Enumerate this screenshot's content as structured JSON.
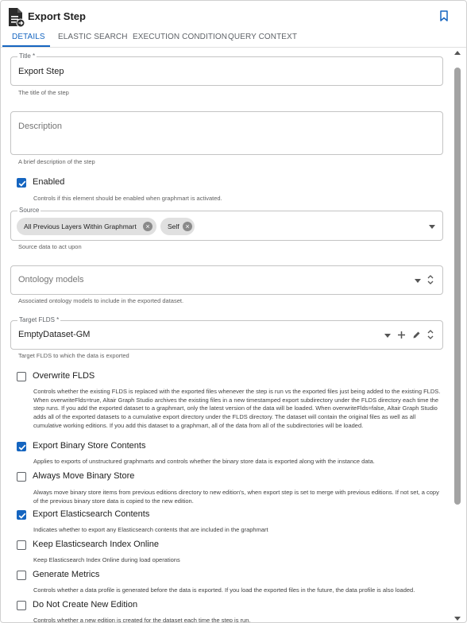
{
  "header": {
    "title": "Export Step",
    "icon": "document-export-icon",
    "bookmark_icon": "bookmark-icon"
  },
  "tabs": [
    {
      "label": "DETAILS",
      "active": true
    },
    {
      "label": "ELASTIC SEARCH",
      "active": false
    },
    {
      "label": "EXECUTION CONDITION",
      "active": false
    },
    {
      "label": "QUERY CONTEXT",
      "active": false
    }
  ],
  "form": {
    "title": {
      "label": "Title *",
      "value": "Export Step",
      "hint": "The title of the step"
    },
    "description": {
      "placeholder": "Description",
      "hint": "A brief description of the step"
    },
    "enabled": {
      "label": "Enabled",
      "checked": true,
      "hint": "Controls if this element should be enabled when graphmart is activated."
    },
    "source": {
      "label": "Source",
      "chips": [
        "All Previous Layers Within Graphmart",
        "Self"
      ],
      "hint": "Source data to act upon"
    },
    "ontology": {
      "placeholder": "Ontology models",
      "hint": "Associated ontology models to include in the exported dataset."
    },
    "target": {
      "label": "Target FLDS *",
      "value": "EmptyDataset-GM",
      "hint": "Target FLDS to which the data is exported"
    },
    "options": [
      {
        "label": "Overwrite FLDS",
        "checked": false,
        "desc": "Controls whether the existing FLDS is replaced with the exported files whenever the step is run vs the exported files just being added to the existing FLDS. When overwriteFlds=true, Altair Graph Studio archives the existing files in a new timestamped export subdirectory under the FLDS directory each time the step runs. If you add the exported dataset to a graphmart, only the latest version of the data will be loaded. When overwriteFlds=false, Altair Graph Studio adds all of the exported datasets to a cumulative export directory under the FLDS directory. The dataset will contain the original files as well as all cumulative working editions. If you add this dataset to a graphmart, all of the data from all of the subdirectories will be loaded."
      },
      {
        "label": "Export Binary Store Contents",
        "checked": true,
        "desc": "Applies to exports of unstructured graphmarts and controls whether the binary store data is exported along with the instance data."
      },
      {
        "label": "Always Move Binary Store",
        "checked": false,
        "desc": "Always move binary store items from previous editions directory to new edition's, when export step is set to merge with previous editions. If not set, a copy of the previous binary store data is copied to the new edition."
      },
      {
        "label": "Export Elasticsearch Contents",
        "checked": true,
        "desc": "Indicates whether to export any Elasticsearch contents that are included in the graphmart"
      },
      {
        "label": "Keep Elasticsearch Index Online",
        "checked": false,
        "desc": "Keep Elasticsearch Index Online during load operations"
      },
      {
        "label": "Generate Metrics",
        "checked": false,
        "desc": "Controls whether a data profile is generated before the data is exported. If you load the exported files in the future, the data profile is also loaded."
      },
      {
        "label": "Do Not Create New Edition",
        "checked": false,
        "desc": "Controls whether a new edition is created for the dataset each time the step is run."
      }
    ]
  },
  "colors": {
    "accent": "#1565c0",
    "chip_bg": "#e0e0e0",
    "border": "#c4c4c4"
  }
}
